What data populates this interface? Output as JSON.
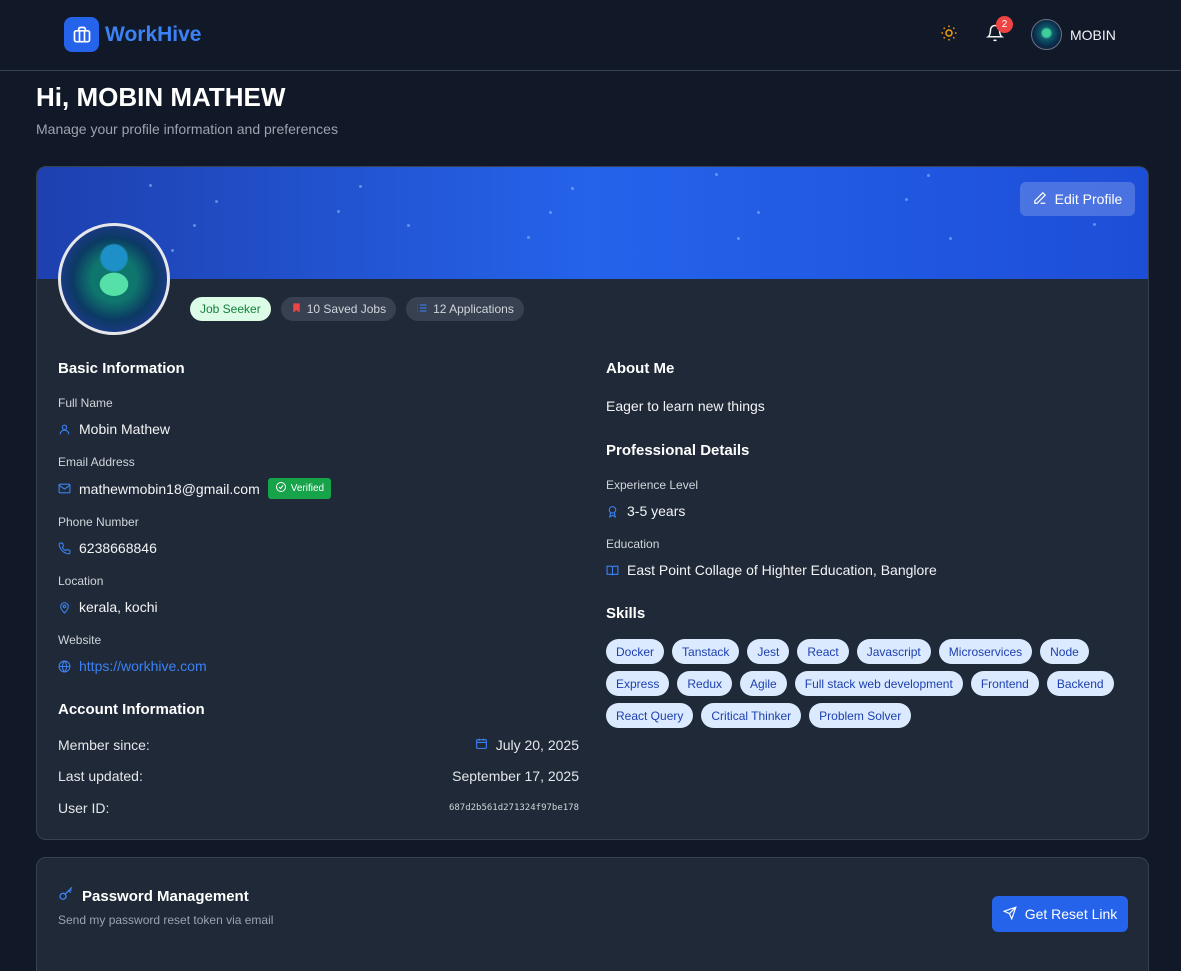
{
  "header": {
    "brand": "WorkHive",
    "notification_count": "2",
    "user_name": "MOBIN"
  },
  "greeting": {
    "title": "Hi, MOBIN MATHEW",
    "subtitle": "Manage your profile information and preferences"
  },
  "profile": {
    "edit_label": "Edit Profile",
    "tags": {
      "role": "Job Seeker",
      "saved": "10 Saved Jobs",
      "applications": "12 Applications"
    }
  },
  "basic_info": {
    "title": "Basic Information",
    "full_name_label": "Full Name",
    "full_name": "Mobin Mathew",
    "email_label": "Email Address",
    "email": "mathewmobin18@gmail.com",
    "verified_label": "Verified",
    "phone_label": "Phone Number",
    "phone": "6238668846",
    "location_label": "Location",
    "location": "kerala, kochi",
    "website_label": "Website",
    "website": "https://workhive.com"
  },
  "account_info": {
    "title": "Account Information",
    "member_since_label": "Member since:",
    "member_since": "July 20, 2025",
    "last_updated_label": "Last updated:",
    "last_updated": "September 17, 2025",
    "user_id_label": "User ID:",
    "user_id": "687d2b561d271324f97be178"
  },
  "about": {
    "title": "About Me",
    "text": "Eager to learn new things"
  },
  "professional": {
    "title": "Professional Details",
    "experience_label": "Experience Level",
    "experience": "3-5 years",
    "education_label": "Education",
    "education": "East Point Collage of Highter Education, Banglore"
  },
  "skills": {
    "title": "Skills",
    "items": [
      "Docker",
      "Tanstack",
      "Jest",
      "React",
      "Javascript",
      "Microservices",
      "Node",
      "Express",
      "Redux",
      "Agile",
      "Full stack web development",
      "Frontend",
      "Backend",
      "React Query",
      "Critical Thinker",
      "Problem Solver"
    ]
  },
  "password": {
    "title": "Password Management",
    "subtitle": "Send my password reset token via email",
    "button": "Get Reset Link"
  },
  "colors": {
    "accent": "#2563eb",
    "background": "#111827",
    "card": "#1f2937",
    "verified": "#16a34a",
    "notification": "#ef4444"
  },
  "icons": [
    "briefcase-icon",
    "sun-icon",
    "bell-icon",
    "pencil-icon",
    "bookmark-icon",
    "list-icon",
    "user-icon",
    "mail-icon",
    "check-circle-icon",
    "phone-icon",
    "map-pin-icon",
    "globe-icon",
    "calendar-icon",
    "award-icon",
    "book-open-icon",
    "key-icon",
    "send-icon"
  ]
}
